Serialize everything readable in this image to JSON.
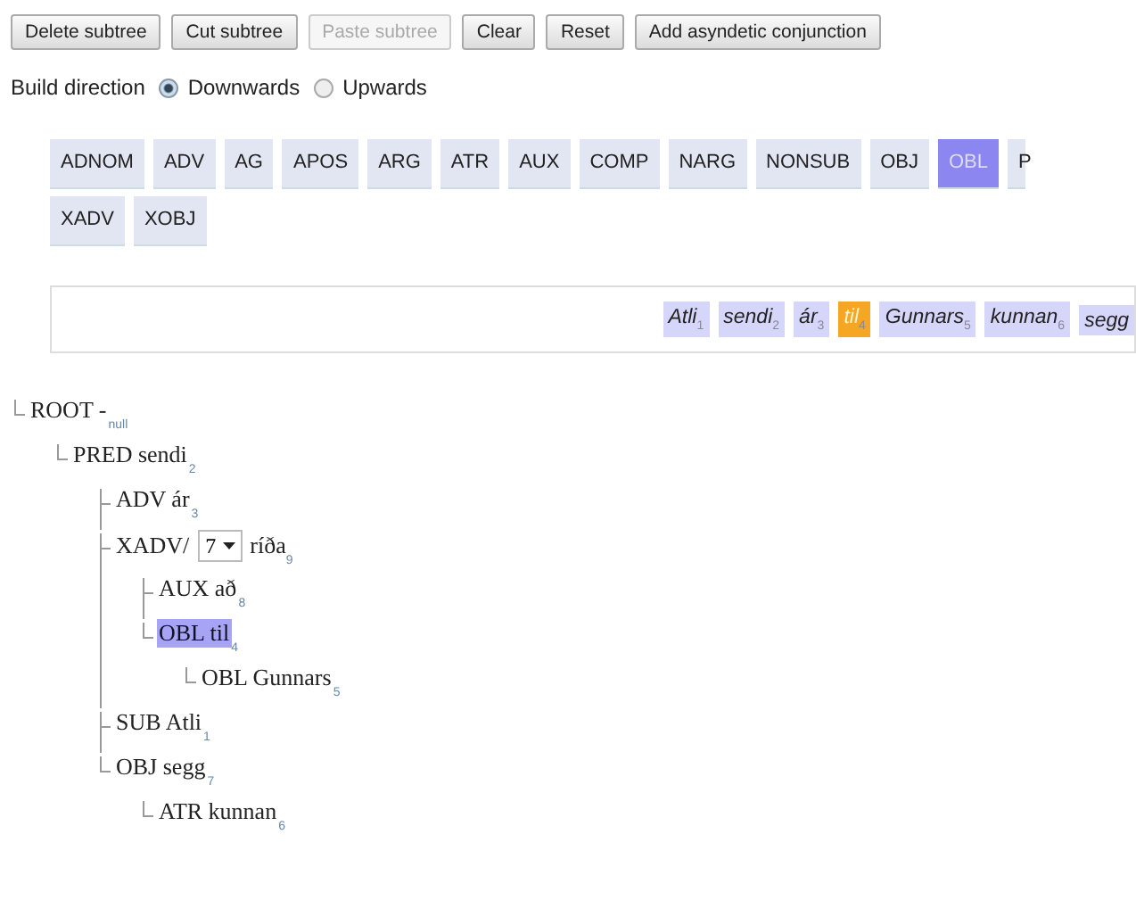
{
  "buttons": [
    {
      "label": "Delete subtree",
      "disabled": false
    },
    {
      "label": "Cut subtree",
      "disabled": false
    },
    {
      "label": "Paste subtree",
      "disabled": true
    },
    {
      "label": "Clear",
      "disabled": false
    },
    {
      "label": "Reset",
      "disabled": false
    },
    {
      "label": "Add asyndetic conjunction",
      "disabled": false
    }
  ],
  "build_direction": {
    "label": "Build direction",
    "options": [
      {
        "label": "Downwards",
        "selected": true
      },
      {
        "label": "Upwards",
        "selected": false
      }
    ]
  },
  "tags": [
    {
      "label": "ADNOM",
      "selected": false
    },
    {
      "label": "ADV",
      "selected": false
    },
    {
      "label": "AG",
      "selected": false
    },
    {
      "label": "APOS",
      "selected": false
    },
    {
      "label": "ARG",
      "selected": false
    },
    {
      "label": "ATR",
      "selected": false
    },
    {
      "label": "AUX",
      "selected": false
    },
    {
      "label": "COMP",
      "selected": false
    },
    {
      "label": "NARG",
      "selected": false
    },
    {
      "label": "NONSUB",
      "selected": false
    },
    {
      "label": "OBJ",
      "selected": false
    },
    {
      "label": "OBL",
      "selected": true
    },
    {
      "label": "P",
      "selected": false
    },
    {
      "label": "XADV",
      "selected": false
    },
    {
      "label": "XOBJ",
      "selected": false
    }
  ],
  "sentence": [
    {
      "word": "Atli",
      "index": "1",
      "selected": false
    },
    {
      "word": "sendi",
      "index": "2",
      "selected": false
    },
    {
      "word": "ár",
      "index": "3",
      "selected": false
    },
    {
      "word": "til",
      "index": "4",
      "selected": true
    },
    {
      "word": "Gunnars",
      "index": "5",
      "selected": false
    },
    {
      "word": "kunnan",
      "index": "6",
      "selected": false
    },
    {
      "word": "segg",
      "selected": false
    }
  ],
  "tree": {
    "label": "ROOT -",
    "index": "null",
    "selected": false,
    "children": [
      {
        "label": "PRED sendi",
        "index": "2",
        "selected": false,
        "children": [
          {
            "label": "ADV ár",
            "index": "3",
            "selected": false
          },
          {
            "label": "XADV/",
            "select": "7",
            "word": "ríða",
            "index": "9",
            "selected": false,
            "children": [
              {
                "label": "AUX að",
                "index": "8",
                "selected": false
              },
              {
                "label": "OBL til",
                "index": "4",
                "selected": true,
                "children": [
                  {
                    "label": "OBL Gunnars",
                    "index": "5",
                    "selected": false
                  }
                ]
              }
            ]
          },
          {
            "label": "SUB Atli",
            "index": "1",
            "selected": false
          },
          {
            "label": "OBJ segg",
            "index": "7",
            "selected": false,
            "children": [
              {
                "label": "ATR kunnan",
                "index": "6",
                "selected": false
              }
            ]
          }
        ]
      }
    ]
  }
}
